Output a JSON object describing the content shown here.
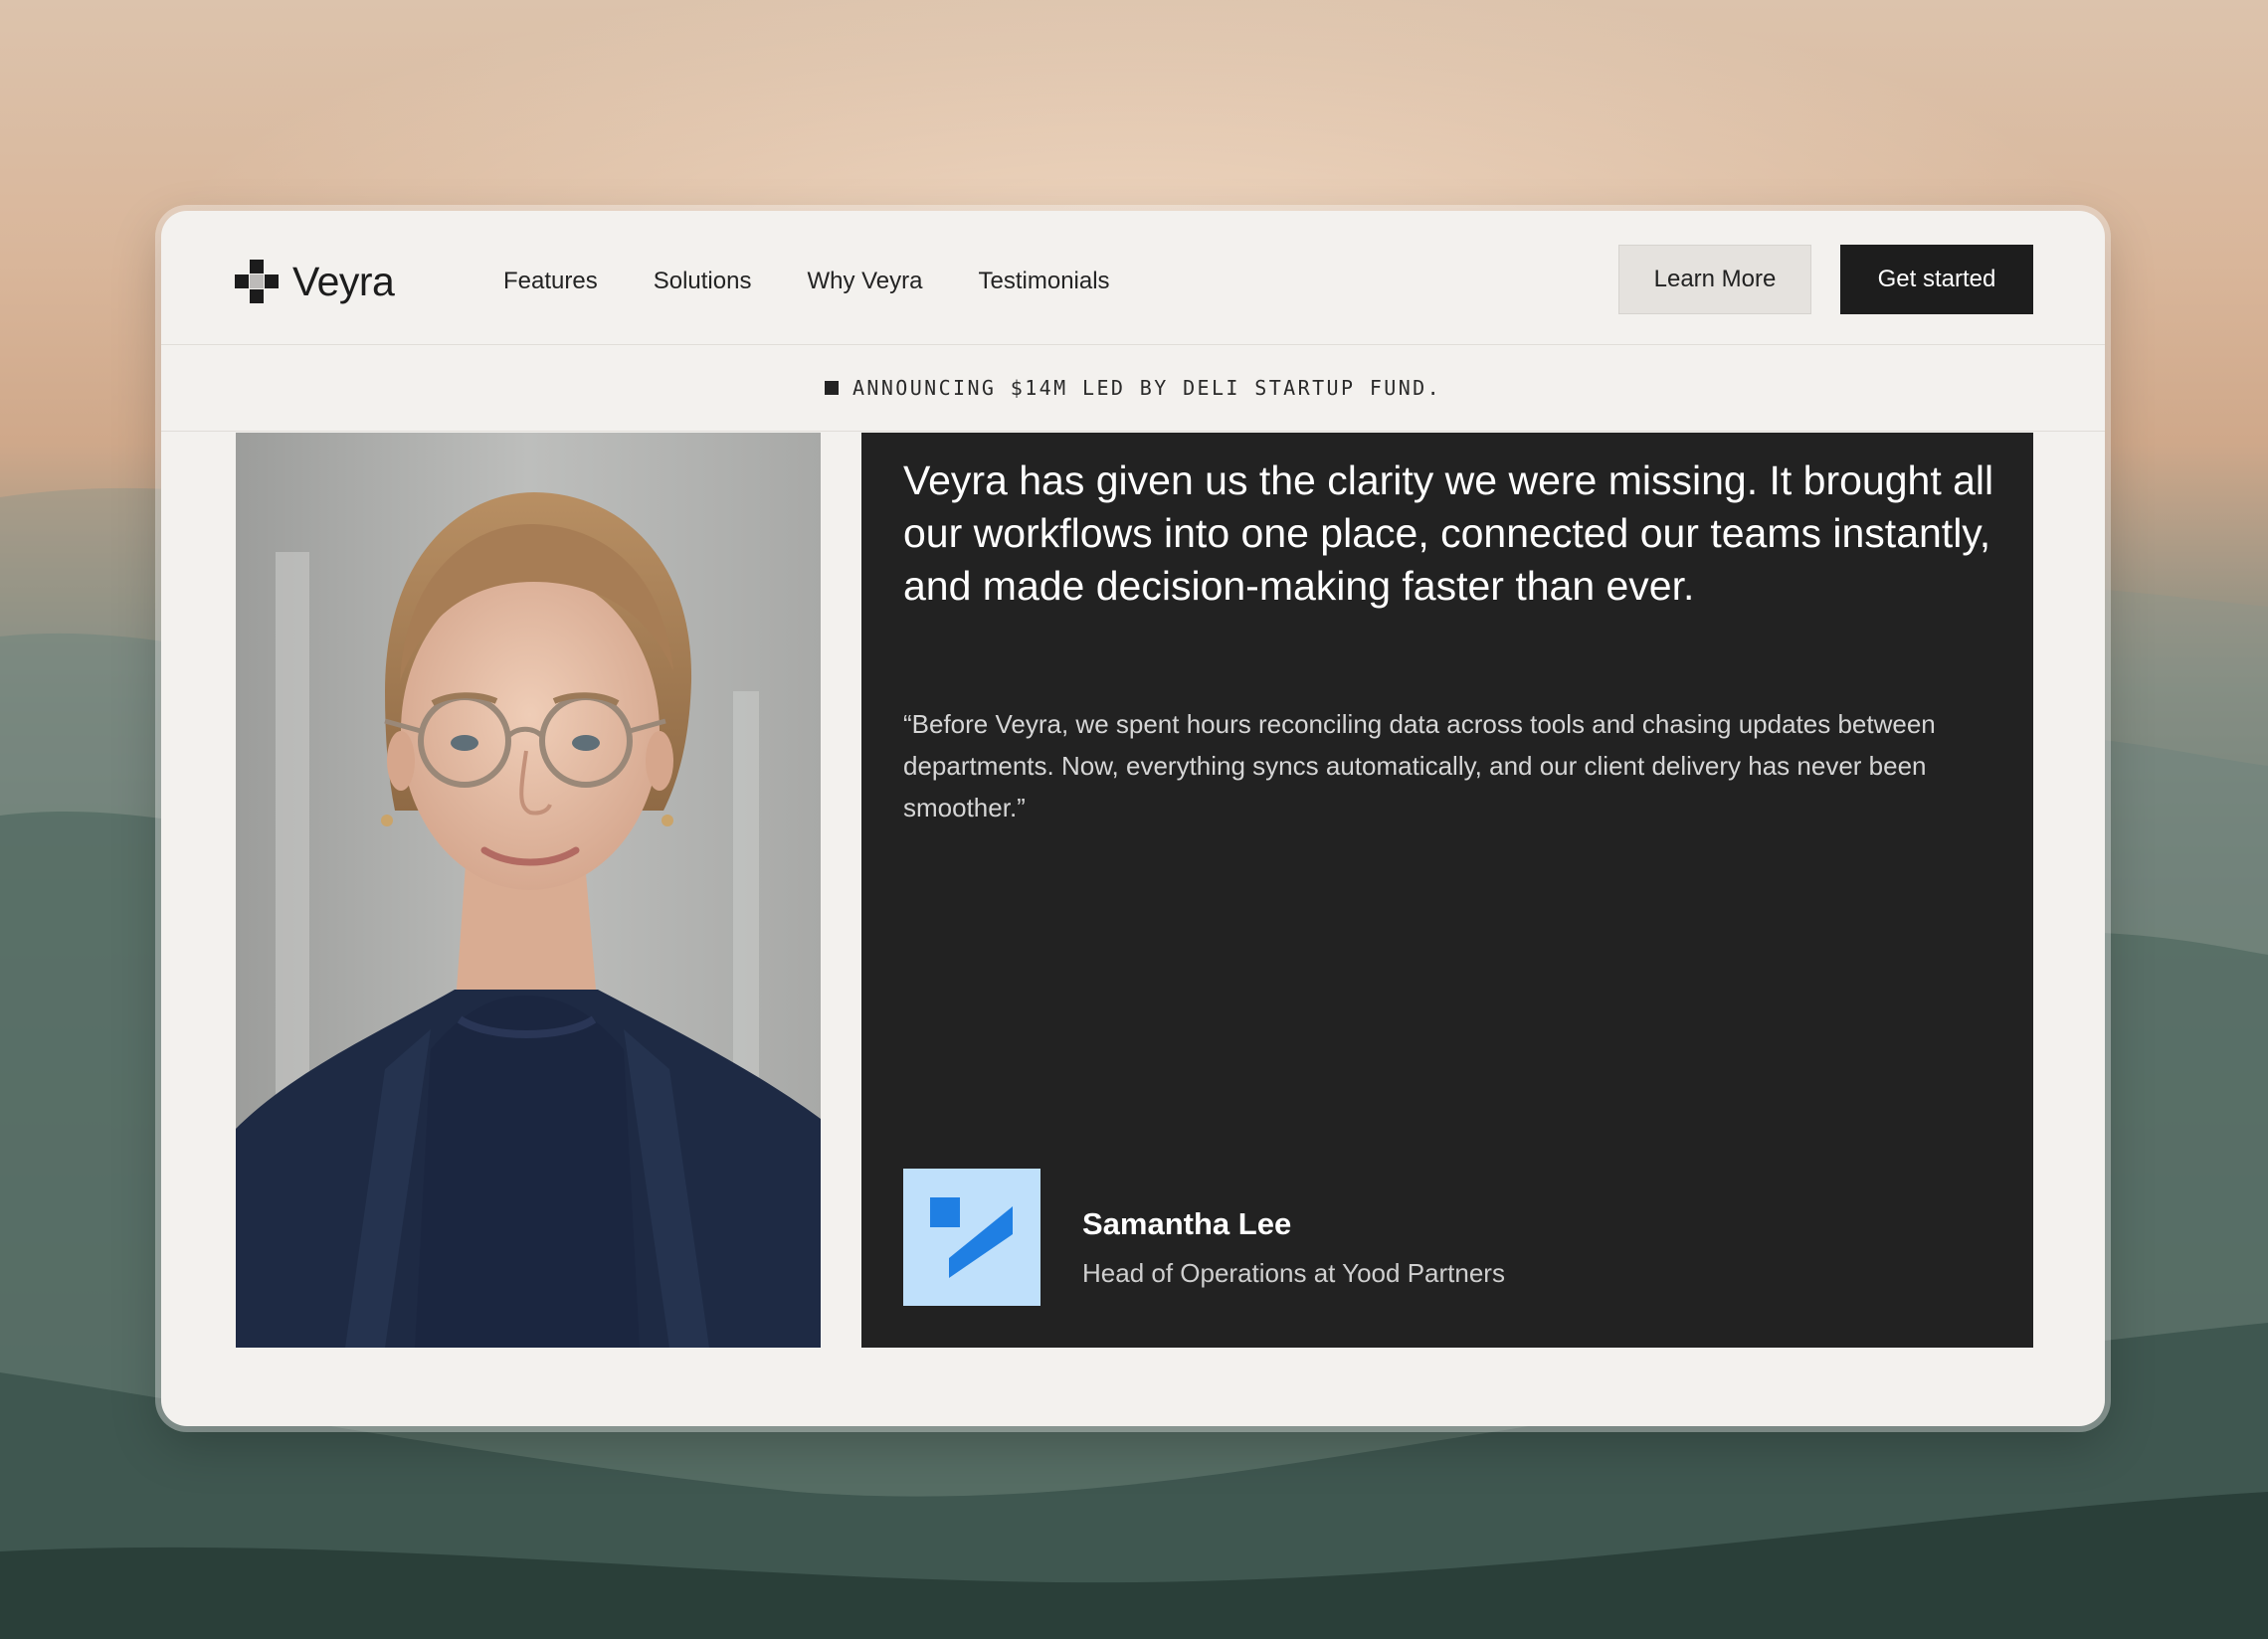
{
  "brand": {
    "name": "Veyra",
    "logo_icon": "plus-cross-icon"
  },
  "nav": {
    "links": [
      "Features",
      "Solutions",
      "Why Veyra",
      "Testimonials"
    ],
    "learn_more": "Learn More",
    "get_started": "Get started"
  },
  "announcement": {
    "icon": "square-bullet-icon",
    "text": "ANNOUNCING $14M LED BY DELI STARTUP FUND."
  },
  "testimonial": {
    "headline": "Veyra has given us the clarity we were missing. It brought all our workflows into one place, connected our teams instantly, and made decision-making faster than ever.",
    "quote": "“Before Veyra, we spent hours reconciling data across tools and chasing updates between departments. Now, everything syncs automatically, and our client delivery has never been smoother.”",
    "author_name": "Samantha Lee",
    "author_title": "Head of Operations at Yood Partners",
    "company_logo_icon": "yood-partners-logo-icon"
  },
  "colors": {
    "card_bg": "#f3f1ee",
    "panel_bg": "#222222",
    "primary_button": "#1d1d1d",
    "secondary_button": "#e5e2de",
    "company_logo_bg": "#bfe0fb",
    "company_logo_fg": "#1f7fe3"
  }
}
